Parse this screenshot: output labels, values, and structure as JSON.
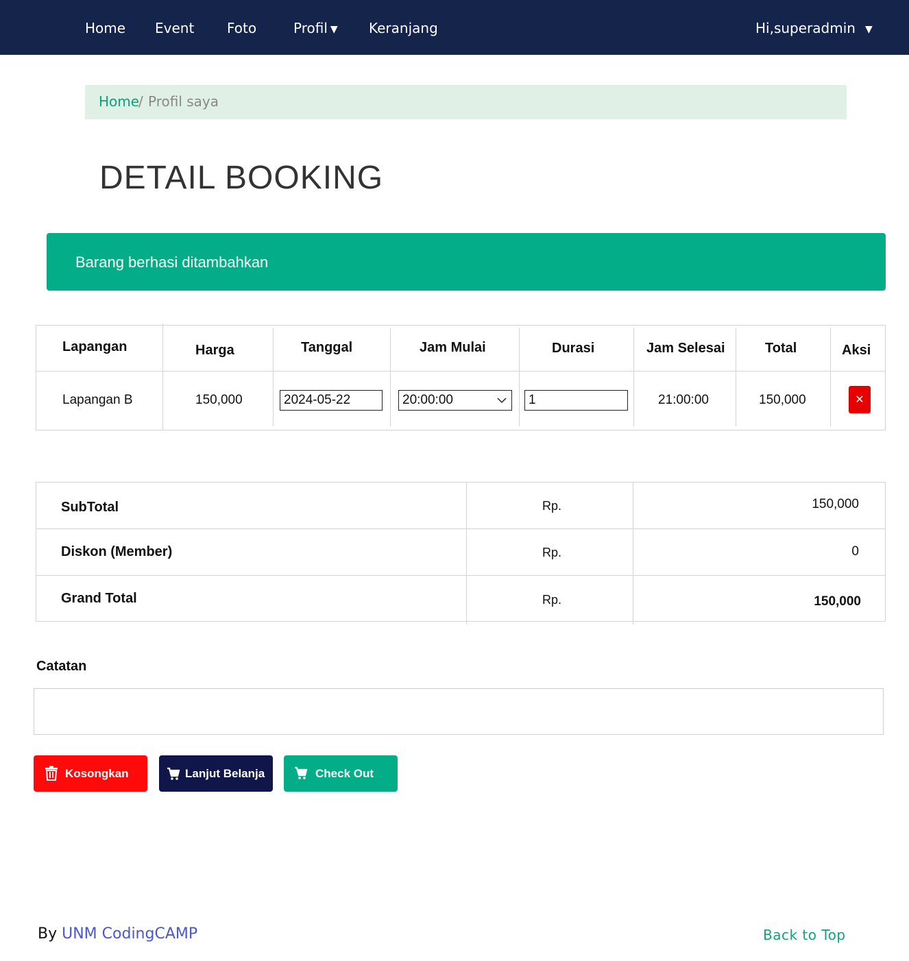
{
  "nav": {
    "home": "Home",
    "event": "Event",
    "foto": "Foto",
    "profil": "Profil",
    "keranjang": "Keranjang",
    "user": "Hi,superadmin",
    "bg_color": "#14244b"
  },
  "breadcrumb": {
    "home": "Home",
    "separator": "/",
    "current": "Profil saya"
  },
  "page_title": "DETAIL BOOKING",
  "alert": {
    "message": "Barang berhasi ditambahkan",
    "color": "#03ad87"
  },
  "cart_table": {
    "headers": [
      "Lapangan",
      "Harga",
      "Tanggal",
      "Jam Mulai",
      "Durasi",
      "Jam Selesai",
      "Total",
      "Aksi"
    ],
    "rows": [
      {
        "lapangan": "Lapangan B",
        "harga": "150,000",
        "tanggal": "2024-05-22",
        "jam_mulai": "20:00:00",
        "durasi": "1",
        "jam_selesai": "21:00:00",
        "total": "150,000",
        "aksi_icon": "close-icon"
      }
    ]
  },
  "summary": {
    "rows": [
      {
        "label": "SubTotal",
        "currency": "Rp.",
        "value": "150,000"
      },
      {
        "label": "Diskon (Member)",
        "currency": "Rp.",
        "value": "0"
      },
      {
        "label": "Grand Total",
        "currency": "Rp.",
        "value": "150,000"
      }
    ]
  },
  "notes": {
    "label": "Catatan",
    "value": ""
  },
  "buttons": {
    "kosongkan": {
      "label": "Kosongkan",
      "icon": "trash-icon",
      "color": "#ff0a0a"
    },
    "lanjut_belanja": {
      "label": "Lanjut Belanja",
      "icon": "cart-icon",
      "color": "#10164a"
    },
    "check_out": {
      "label": "Check Out",
      "icon": "cart-icon",
      "color": "#03ad87"
    }
  },
  "footer": {
    "by": "By",
    "link": "UNM CodingCAMP",
    "back_to_top": "Back to Top"
  }
}
